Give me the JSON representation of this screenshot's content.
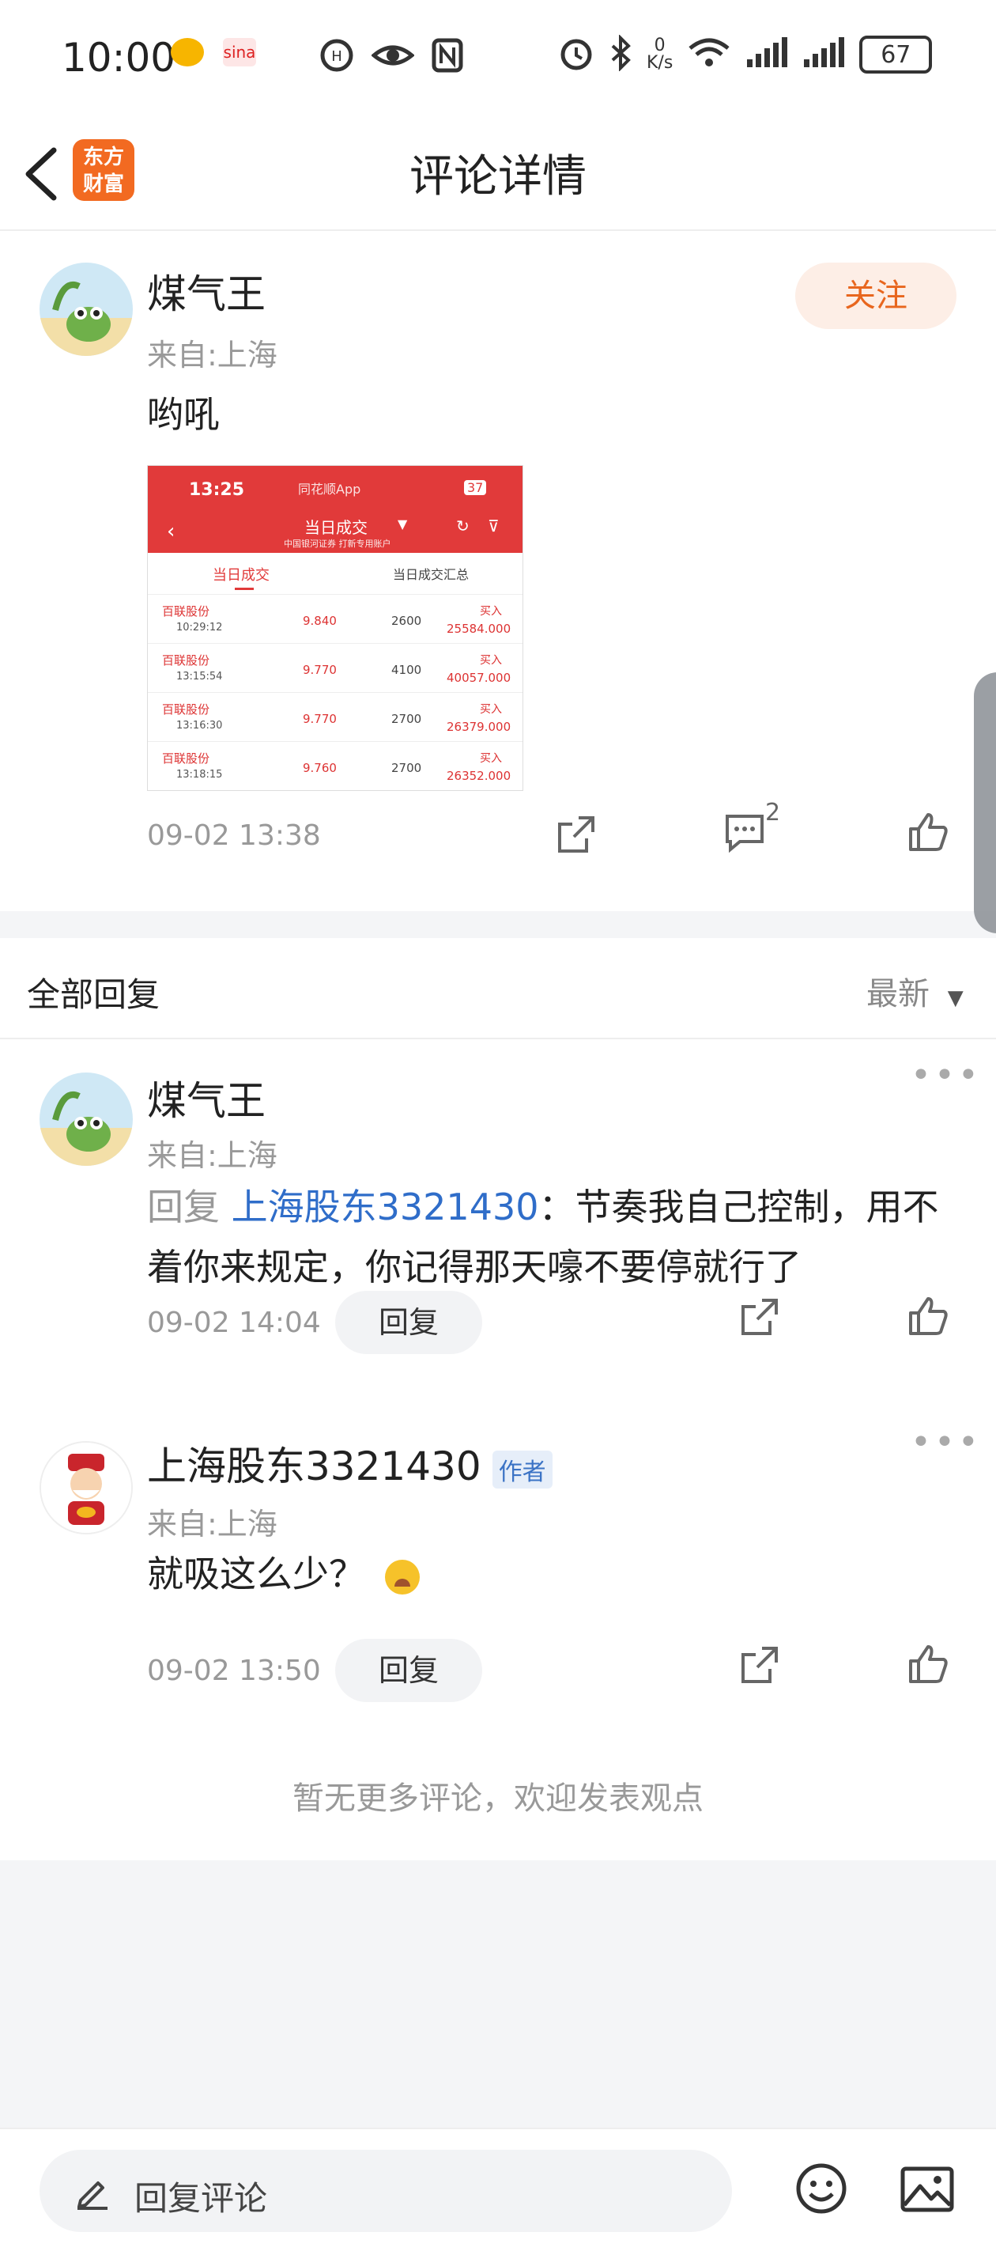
{
  "status_bar": {
    "time": "10:00",
    "net_speed": "0\nK/s",
    "battery": "67"
  },
  "header": {
    "title": "评论详情",
    "logo_text": "东方\n财富"
  },
  "post": {
    "user_name": "煤气王",
    "from": "来自:上海",
    "follow_label": "关注",
    "text": "哟吼",
    "timestamp": "09-02 13:38",
    "comment_count": "2",
    "screenshot": {
      "time": "13:25",
      "app": "同花顺App",
      "battery": "37",
      "title": "当日成交",
      "subtitle": "中国银河证券 打新专用账户",
      "tabs": [
        "当日成交",
        "当日成交汇总"
      ],
      "rows": [
        {
          "name": "百联股份",
          "time": "10:29:12",
          "price": "9.840",
          "qty": "2600",
          "side": "买入",
          "amount": "25584.000"
        },
        {
          "name": "百联股份",
          "time": "13:15:54",
          "price": "9.770",
          "qty": "4100",
          "side": "买入",
          "amount": "40057.000"
        },
        {
          "name": "百联股份",
          "time": "13:16:30",
          "price": "9.770",
          "qty": "2700",
          "side": "买入",
          "amount": "26379.000"
        },
        {
          "name": "百联股份",
          "time": "13:18:15",
          "price": "9.760",
          "qty": "2700",
          "side": "买入",
          "amount": "26352.000"
        }
      ]
    }
  },
  "replies_section": {
    "title": "全部回复",
    "sort_label": "最新",
    "replies": [
      {
        "user_name": "煤气王",
        "from": "来自:上海",
        "reply_prefix": "回复 ",
        "reply_to": "上海股东3321430",
        "text": "：节奏我自己控制，用不着你来规定，你记得那天嚎不要停就行了",
        "timestamp": "09-02 14:04",
        "reply_label": "回复"
      },
      {
        "user_name": "上海股东3321430",
        "author_tag": "作者",
        "from": "来自:上海",
        "text": "就吸这么少？",
        "timestamp": "09-02 13:50",
        "reply_label": "回复"
      }
    ],
    "end_text": "暂无更多评论，欢迎发表观点"
  },
  "bottom_bar": {
    "placeholder": "回复评论"
  },
  "colors": {
    "accent_orange": "#e8661e",
    "link_blue": "#2f6dc9",
    "screenshot_red": "#e13a3a"
  }
}
